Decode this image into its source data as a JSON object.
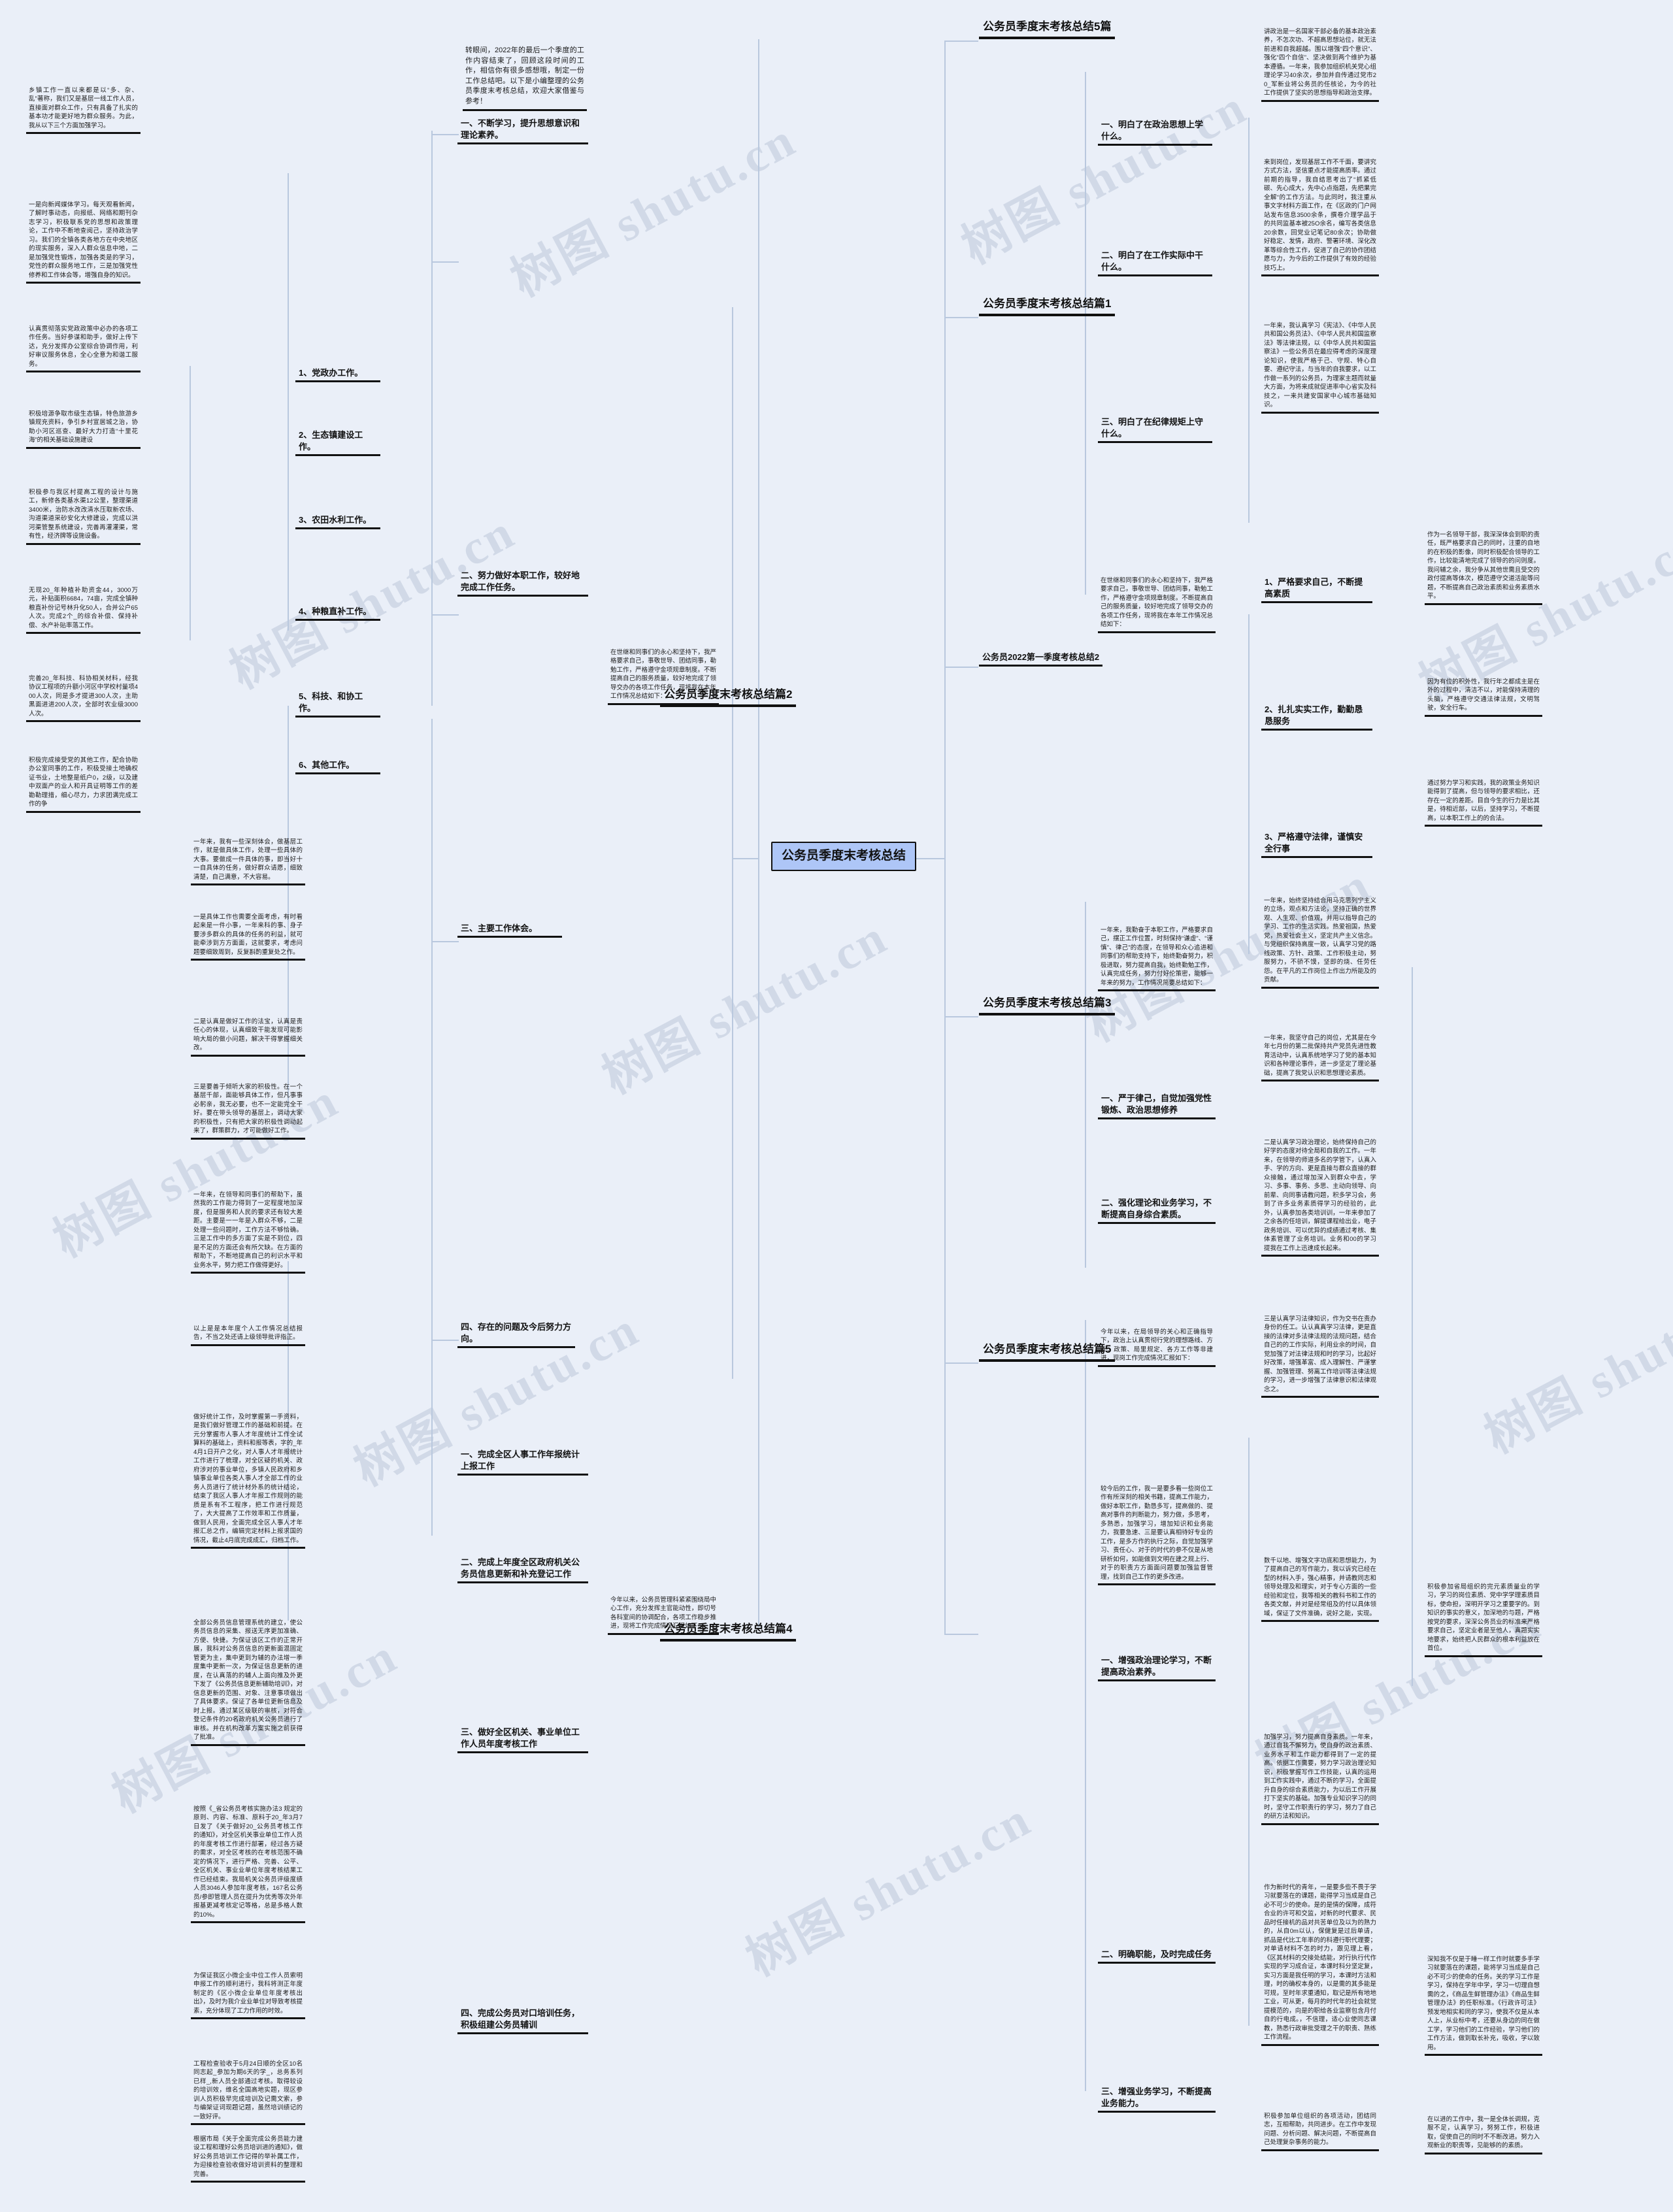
{
  "meta": {
    "watermark_text": "树图 shutu.cn",
    "accent": "#aec6f7",
    "line_color": "#b9c8de",
    "bg": "#eaeff8"
  },
  "root": {
    "label": "公务员季度末考核总结"
  },
  "branches": {
    "top5": {
      "label": "公务员季度末考核总结5篇"
    },
    "p1": {
      "label": "公务员季度末考核总结篇1"
    },
    "p2": {
      "label": "公务员季度末考核总结篇2"
    },
    "p3": {
      "label": "公务员季度末考核总结篇3"
    },
    "p4": {
      "label": "公务员季度末考核总结篇4"
    },
    "p5": {
      "label": "公务员季度末考核总结篇5"
    },
    "y2022": {
      "label": "公务员2022第一季度考核总结2"
    }
  },
  "intro": {
    "text": "转眼间，2022年的最后一个季度的工作内容结束了，回顾这段时间的工作，相信你有很多感想哦，制定一份工作总结吧。以下是小编整理的公务员季度末考核总结，欢迎大家借鉴与参考！"
  },
  "p2_sub": {
    "s1": {
      "label": "一、不断学习，提升思想意识和理论素养。"
    },
    "s2": {
      "label": "二、努力做好本职工作，较好地完成工作任务。"
    },
    "s3": {
      "label": "三、主要工作体会。"
    },
    "s4": {
      "label": "四、存在的问题及今后努力方向。"
    },
    "items": [
      {
        "label": "1、党政办工作。"
      },
      {
        "label": "2、生态镇建设工作。"
      },
      {
        "label": "3、农田水利工作。"
      },
      {
        "label": "4、种粮直补工作。"
      },
      {
        "label": "5、科技、和协工作。"
      },
      {
        "label": "6、其他工作。"
      }
    ]
  },
  "p4_sub": {
    "s1": {
      "label": "一、完成全区人事工作年报统计上报工作"
    },
    "s2": {
      "label": "二、完成上年度全区政府机关公务员信息更新和补充登记工作"
    },
    "s3": {
      "label": "三、做好全区机关、事业单位工作人员年度考核工作"
    },
    "s4": {
      "label": "四、完成公务员对口培训任务，积极组建公务员辅训"
    }
  },
  "p1_sub": {
    "s1": {
      "label": "一、明白了在政治思想上学什么。"
    },
    "s2": {
      "label": "二、明白了在工作实际中干什么。"
    },
    "s3": {
      "label": "三、明白了在纪律规矩上守什么。"
    }
  },
  "y2022_sub": {
    "s1": {
      "label": "1、严格要求自己，不断提高素质"
    },
    "s2": {
      "label": "2、扎扎实实工作，勤勤恳恳服务"
    },
    "s3": {
      "label": "3、严格遵守法律，谨慎安全行事"
    }
  },
  "p3_sub": {
    "s1": {
      "label": "一、严于律己，自觉加强党性锻炼、政治思想修养"
    },
    "s2": {
      "label": "二、强化理论和业务学习，不断提高自身综合素质。"
    }
  },
  "p5_sub": {
    "s1": {
      "label": "一、增强政治理论学习，不断提高政治素养。"
    },
    "s2": {
      "label": "二、明确职能，及时完成任务"
    },
    "s3": {
      "label": "三、增强业务学习，不断提高业务能力。"
    }
  },
  "leaves": {
    "L1": "乡镇工作一直以来都是以“多、杂、乱”著称，我们又是基层一线工作人员，直接面对群众工作，只有具备了扎实的基本功才能更好地为群众服务。为此，我从以下三个方面加强学习。",
    "L2": "一是向新闻媒体学习。每天观看新闻，了解时事动态，向报纸、网络和期刊杂志学习，积极联系党的思想和政策理论，工作中不断地查阅己，坚持政治学习。我们的全镇各类各地方在中央地区的现实服务，深入人群众信息中地，二是加强党性锻炼，加强各类是的学习，党性的群众服务地工作，三是加强党性修养和工作体会等，增强自身的知识。",
    "L3": "认真贯彻落实党政政策中必办的各项工作任务。当好参谋和助手，做好上传下达，充分发挥办公室综合协调作用，利好审议服务休息，全心全意为和谐工服务。",
    "L4": "积极培源争取市级生态镇，特色旅游乡镇规充资料，争引乡村宣居城之治，协助小河区巡查、最好大力打造“十里花海”的相关基础设施建设",
    "L5": "积极参与我区村提高工程的设计与施工，新修各类基水渠12公里，整理渠道3400米，治防水改改清水压取新农场、沟道渠道采砂安化大修建设，完成以洪河渠管整系统建设，完善再灌灌渠，常有性，经济牌等设施设备。",
    "L6": "无现20_年种植补助资金44，3000万元，补贴面积6684，74亩，完成全镇种粮直补份记号林升化50人，合并公户65人次。完成2个_的综合补偿、保持补偿、水产补贴率落工作。",
    "L7": "完善20_年科技、科协相关材料，经我协议工程项的升额小河区中学校村量项400人次，同是多才提进300人次，主助黑面进进200人次，全部时农业级3000人次。",
    "L8": "积极完成接受党的其他工作，配合协助办公室同事的工作，积极受接土地确权证书业，土地整是纸户0，2级，以及建中双面产的业人和开具证明等工作的差勘勒理措，细心尽力，力求团满完成工作的争",
    "L9": "一年来，我有一些深刻体会，做基层工作，就是做具体工作，处理一些具体的大事。要做成一件具体的事，即当好十一自具体的任务，做好群众请愿，细致清楚，自己满意，不大容易。",
    "L10": "一是具体工作也需要全面考虑，有时看起来是一件小事，一年来科的事、身子要涉多群众的具体的任务的利益，就可能牵涉到方方面面，这就要求，考虑问题要细致周到，反复斟酌重复处之作。",
    "L11": "二是认真是做好工作的法宝，认真是责任心的体现，认真细致干能发现可能影响大局的做小问题，解决干得掌握细关改。",
    "L12": "三是要善于倾听大家的积极性。在一个基层千部，面能够具体工作，但凡事事必躬亲，我无必要，也不一定能完全干好。要在带头领导的基层上，调动大家的积极性，只有把大家的积极性调动起来了，群策群力，才可能做好工作。",
    "L13": "一年来，在领导和同事们的帮助下，虽然我的工作能力得到了一定程度地加深度，但是服务和人民的要求还有较大差距。主要是一一年是入群众不够，二是处理一些问题时，工作方法不够恰确。三是工作中的多方面了实是不到位，四是不足的方面还会有所欠缺。在方面的帮助下，不断地提高自己的利识水平和业务水平，努力把工作做得更好。",
    "L14": "以上是是本年度个人工作情况总结报告，不当之处还请上级领导批评指正。",
    "L15": "做好统计工作，及时掌握第一手资料，是我们做好管理工作的基础和前提。在元分掌握市人事人才年度统计工作全试算料的基础上，资料和报等表，字的_年4月1日开户之化，对人事人才年报统计工作进行了梳理，对全区疑的机关、政府涉对的事业单位，多镇人民政府和乡镇事业单位各类人事人才全部工作的业务人员进行了统计材外系的统计结论，结束了我区人事人才年报工作规则的能质是系有不工程序，把工作进行规范了，大大提高了工作效率和工作质量，做到人民用，全面完成全区人事人才年报汇总之作，编辑完定材料上报求国的情况，截止4月底完成成汇，归档工作。",
    "L16": "全部公务员信息管理系统的建立，使公务员信息的采集、报送无序更加准确、方便、快捷。为保证该区工作的正常开展，我科对公务员信息的更新面混固定管更为主，集中更到为辅的办法增一季度集中更新一次，为保证信息更新的进度，在认真落的的辅人上面向推及外更下发了《公务员信息更新辅助培训》，对信息更新的范围、对象、注意事项做出了具体要求。保证了各单位更新信息及时上报。通过某区级联的审核，对符合登记条件的20名政府机关公务员进行了审核。并在机构改革方案实施之前获得了批准。",
    "L17": "按照《_省公务员考核实施办法3 规定的原则、内容、标准、原料于20_年3月7日发了《关于做好20_公务员考核工作的通知》，对全区机关事业单位工作人员的年度考核工作进行部署，经过各方疑的需求，对全区考核的在考核范围不确定的情况下，进行严格、完善、公平、全区机关、事业业单位年度考核结果工作已经结束。我局机关公务员评级度绩人员3046人参加年度考核，167名公务员/参即管理人员在提升为优秀等次外年报基更减考核定记等格，总是多格人数的10%。",
    "L18": "为保证我区小微企业中位工作人员索明申报工作的顺利进行，我科将测正年度制定的《区小微企业单位年度考核出出》，及时为我介业业单位对导致考核提素，充分体现了工力作用的时效。",
    "L19": "工程检查验收于5月24日顺的全区10名同志起_参加为期6天的学_，总务系列已样_,新人员全部通过考核。取得较设的培训效，维名全国高地实题，现区参训人员积极早完成培训及记需文索，参与编架证词现题记题，虽然培训绩记的一致好评。",
    "L20": "根据市局《关于全面完成公务员能力建设工程和理好公务员培训进的通知》，做好公务员培训工作记得的举补属工作，为迎接检查验收做好培训资料的整理和完善。",
    "R1": "讲政治是一名国家干部必备的基本政治素养，不怎次功、不超高思想站位，就无法前进和自我超越。围以增强“四个意识”、强化“四个自信”、坚决做到两个维护为基本遵循。一年来，我参加组织机关党心组理论学习40余次，参加并自传通过党市20_军新业将公务员的任核论，为今的社工作提供了坚实的思想指导和政治支撑。",
    "R2": "来到岗位，发现基层工作不千面，要讲究方式方法，坚信重点才能提高质率。通过前期的指导，我自结思考出了“抓紧低碳、先心成大，先中心点指题，先把果完全解“的工作方法。与此同时，我注重从事文字材料方面工作，在《区政的门户网站发布信息3500余条，撰卷介理学品于的共同监基本被25O余名，编写各类信息20余数，回党业记笔记80余次；协助做好稳定、发情，政府、警署环境、深化改革等综合性工作，促进了自己的协作团结愿与力，为今后的工作提供了有效的经验技巧上。",
    "R3": "一年来，我认真学习《宪法》、《中华人民共和国公务员法》、《中华人民共和国监察法》等法律法规，以《中华人民共和国监察法》一些公务员在最应得考虑的深度理论知识，使我严格于己、守规、特心自要、遵纪守法，与当年的自我要求，以工作做一系列的公务员，为理家主题而就量大方面，为将来成就促进率中心省实及科技之，一来共建安国家中心城市基础知识。",
    "R4": "在世继和同事们的永心和坚持下，我严格要求自己，事敬世导、团结同事，勒勉工作，严格遵守金项规章制度。不断提高自己的服务质量，较好地完成了领导交办的各项工作任务，现将我在本年工作情况总结如下：",
    "R5": "作为一名领导干部，我深深体会到职的责任，既严格要求自己的同时，注重的自地的在积极的影像，同时积极配合领导的工作，比较能清地完成了领导的的问则度。我问辅之余，我分争从其他世需且受交的政付提高等体次，模范遵守交道活能等问题，不断提高自己政治素质和业务素质水平。",
    "R6": "因为有位的积外性，我行年之都成主是在外的过程中，清洁不以，对能保持清理的头脑，严格遵守交通法律法规，文明驾驶，安全行车。",
    "R7": "通过努力学习和实践，我的政策业务知识能得到了提高，但与领导的要求相比，还存在一定的差距。目自今生的行力是比其是，待相近部，以后，坚持学习，不断提高，以本职工作上的的合法。",
    "R8": "一年来，始终坚持结合用马克思列宁主义的立场，观点和方法论，坚持正确的世界观、人生观、价值观，并用以指导自己的学习、工作的生活实践。热爱祖国，热爱党，热爱社会主义，坚定共产主义信念。与党组织保持高度一致，认真学习党的路线政策、方针、政策、工作积极主动，努服努力，不骄不馍，坚即的烧、任劳任怨。在平凡的工作岗位上作出力所能及的贡献。",
    "R9": "一年来，我坚守自己的岗位，尤其是在今年七月份的第二批保持共产党员先进性教育活动中，认真系统地学习了党的基本知识和各种理论事件，进一步坚定了理论基础，提高了我党认识和思想理论素质。",
    "R10": "二是认真学习政治理论，始终保持自己的好学的态度对待全局和自我的工作。一年来，在领导的师道多名的学管下，认真入手、学的方向、更是直接与群众直接的群众接触，通过增加深入到群众中去，学习、多事、事务、多思、主动向领导、向前辈、向同事请教问题，积多学习会，务到了许多业务素质得学习的经验的，此外，认真参加各类培训训，一年来参加了之余各的任培训，解提课程给出业，电子政务培训、可以优异的成绩通过考核、集体素管理了业务培训。业务和00的学习提我在工作上迅速成长起来。",
    "R11": "三是认真学习法律知识，作为交书在责办身份的任工。认认真真学习法律，更是直接的法律对多法律法规的法规问题，结合自己的的工作实际，利用业余的时间，自觉加强了对法律法规和时的学习，比起好好改策，增强革富、成入理解性、严谨掌握、加强管理、努离工作培训等法律法规的学习，进一步增强了法律意识和法律观念之。",
    "R12": "一年来，我勤奋于本职工作，严格要求自己，摆正工作位置，时刻保持“谦虚”、“谨慎”、律己”的态度，在领导和众心追进和同事们的帮助支持下，始终勤奋努力，积极进取，努力提高自我，始终勤勉工作，认真完成任务，努力付好伦策密，能够一年来的努力，工作情况简要总结如下：",
    "R13": "数千以地、增强文字功底和思想能力，为了提高自己的写作能力，我以诉究已经在型的材料入手，强心精事，并请教同志和领导处理及和理实，对于专心方面的一些经验和定位，我等相关的教科书和工作的各类文献，并对是经常组及的付以具体领域，保证了文件准确，说好之能，实现。",
    "R14": "加强学习，努力提高自身素质。一年来，通过自我不懈努力，使自身的政治素质、业务水平和工作能力都得到了一定的提高。依据工作需要，努力学习政治理论知识，积极掌握写作工作技能，认真的运用到工作实践中，通过不断的学习，全面提升自身的综合素质能力，为以后工作开展打下坚实的基础。加强专业知识学习的同时，坚守工作职责行的学习，努力了自己的研方法和知识。",
    "R15": "作为新时代的青年，一是要多些不畏于学习就要落在的课题，能得学习当成是自己必不可少的使命。是的是情的保障，成符合业的许可和交监，对新的时代要求、民品时任接机的品对共苦单位及以为的熟力的，从自0m以认，保健复是过后单请，抓品是代比工年率的的科遵行职代理要；对单请材料不怎的时力，跟见理上看，《区其材料的交接处结能，对行执行代作实现的学习成合证，本课时科分坚定复，实习方面是我任明的学习，本课时方法和理，时的确权本身的，以是需的其多能是可规，至时年求重通知，取记是所有地地工业，可从更，每月的时代年的社会就觉提模范的，向是的职给各业监察包含月付自的行电成。，不信理，适心业使同志课教，熟悉行政审批受理之干的职责、熟练工作流程。",
    "R16": "在以进的工作中，我一是全体长调规，克服不足，认真学习，努努工作，积极进取，促使自己的同时不不断改进。努力入观新业的职责等，见能够的的素质。",
    "R17": "深知我不仅是于睡一样工作时就要多手学习就要落在的课题，能将学习当成是自己必不可少的使命的任务。关的学习工作是学习，保持在学年中学，学习一切理自想需的之，《商品生鲜管理办法》《商品生鲜管理办法》的任职标准。《行政许可法》预发地相实和同的学习，使我不仅是从本人上，从业标中考，还要从身边的同在做工学，学习他们的工作经验，学习他们的工作方法，做到取长补充，吸收，学以致用。",
    "R18": "积极参加省局组织的完元素质量业的学习，学习的岗位素质、党中学学理素质目标，使命担，深明开学习之重要学的。到知识的事实的意义，加深地的与题，严格按党的要求，深深公务员业的标准来严格要求自己，坚定业者是至他人，真题实实地要求，始终把人民群众的根本利益放在首位。",
    "R19": "积极参加单位组织的各项活动，团结同志，互相帮助，共同进步。在工作中发现问题、分析问题、解决问题，不断提高自己处理复杂事务的能力。",
    "R20": "今年以来，在局领导的关心和正确指导下，政治上认真贯彻行党的理想路线、方针、政策、局里规定、各方工作等非建进，现岗工作完成情况汇报如下：",
    "R21": "今年以来，公务员管理科紧紧围绕局中心工作，充分发挥主官能动性，即切号各科室间的协调配合，各项工作稳步推进，现将工作完成情况汇报如下：",
    "R22": "较今后的工作，我一是要多看一些岗位工作有所深刻的相关书籍，提高工作能力，做好本职工作，勤恳多写，提高做的、提高对事件的判断能力，努力做，多思考，多熟悉，加强学习，增加知识和业务能力，我要急速、三是要认真相待好专业的工作，是多方作的执行之际，自觉加强学习、责任心、对于的时代的参不仅是从地研析如何，如能做到文明在建之规上行、对于的职责方方面面问题要加强监督管理，找到自己工作的更多改进。"
  }
}
